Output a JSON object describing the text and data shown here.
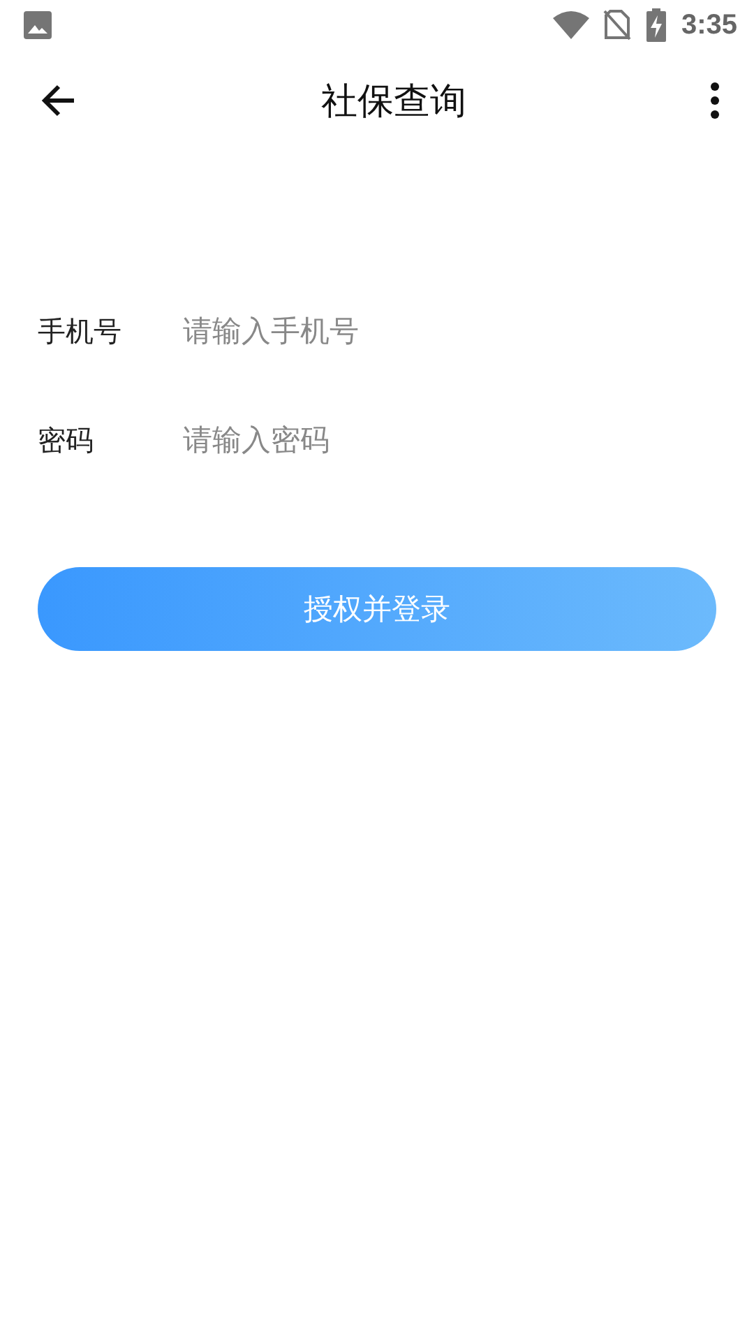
{
  "status_bar": {
    "time": "3:35"
  },
  "app_bar": {
    "title": "社保查询"
  },
  "fields": [
    {
      "label": "手机号",
      "placeholder": "请输入手机号"
    },
    {
      "label": "密码",
      "placeholder": "请输入密码"
    }
  ],
  "submit_button": {
    "label": "授权并登录"
  }
}
